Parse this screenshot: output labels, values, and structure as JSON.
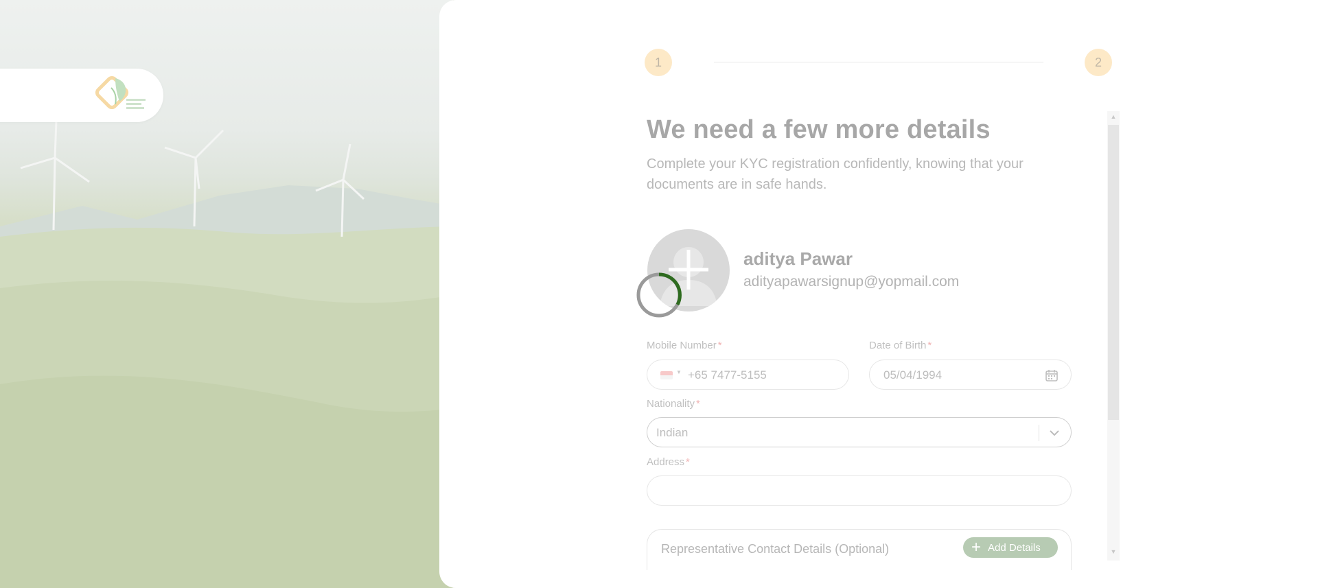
{
  "stepper": {
    "step1": "1",
    "step2": "2"
  },
  "heading": {
    "title": "We need a few more details",
    "subtitle": "Complete your KYC registration confidently, knowing that your documents are in safe hands."
  },
  "user": {
    "name": "aditya Pawar",
    "email": "adityapawarsignup@yopmail.com"
  },
  "form": {
    "mobile": {
      "label": "Mobile Number",
      "required_mark": "*",
      "value": "+65 7477-5155",
      "flag": "singapore-flag-icon"
    },
    "dob": {
      "label": "Date of Birth",
      "required_mark": "*",
      "value": "05/04/1994"
    },
    "nationality": {
      "label": "Nationality",
      "required_mark": "*",
      "value": "Indian"
    },
    "address": {
      "label": "Address",
      "required_mark": "*",
      "value": ""
    }
  },
  "representative": {
    "label": "Representative Contact Details (Optional)",
    "button": "Add Details"
  },
  "colors": {
    "accent_green": "#2e6b1f",
    "step_bg": "#fde9c7",
    "button_green": "#b7cbb3"
  }
}
